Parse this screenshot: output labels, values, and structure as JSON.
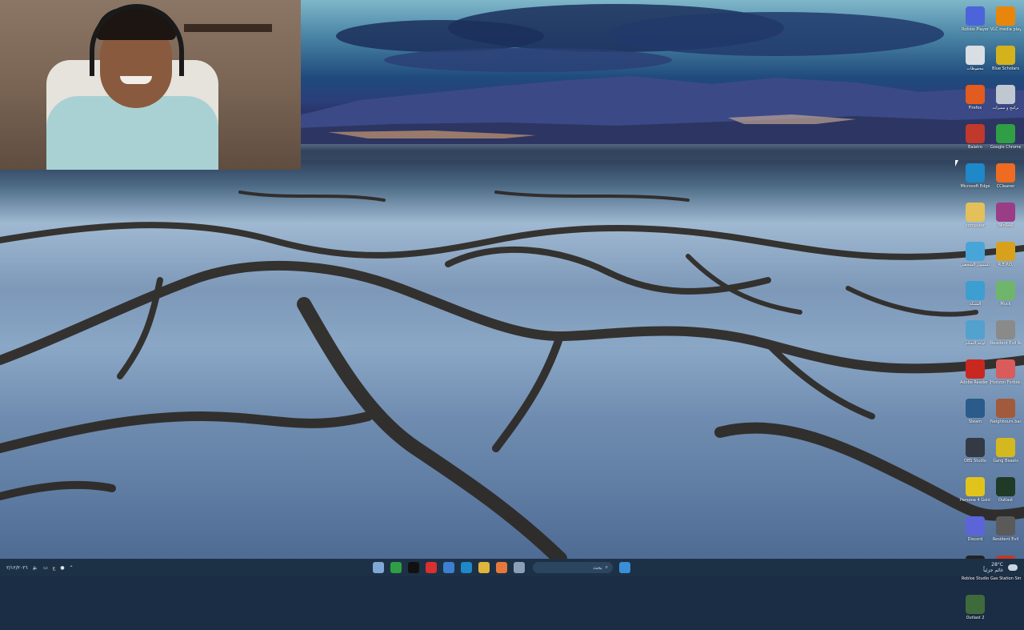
{
  "desktop_icons": [
    {
      "id": "roblox-player",
      "label": "Roblox Player",
      "color": "#4c64d9"
    },
    {
      "id": "vlc",
      "label": "VLC media player",
      "color": "#e8860c"
    },
    {
      "id": "folder-top",
      "label": "محفوظات",
      "color": "#d9dde4"
    },
    {
      "id": "blue-scholar",
      "label": "Blue Scholars",
      "color": "#d4b21c"
    },
    {
      "id": "firefox",
      "label": "Firefox",
      "color": "#e25b1f"
    },
    {
      "id": "settings",
      "label": "برامج و مميزات",
      "color": "#bfc8d0"
    },
    {
      "id": "balatro",
      "label": "Balatro",
      "color": "#c0392b"
    },
    {
      "id": "chrome",
      "label": "Google Chrome",
      "color": "#2f9e44"
    },
    {
      "id": "edge",
      "label": "Microsoft Edge",
      "color": "#1e88c9"
    },
    {
      "id": "ccleaner",
      "label": "CCleaner",
      "color": "#ee6b21"
    },
    {
      "id": "computer-folder",
      "label": "computer",
      "color": "#e4c05a"
    },
    {
      "id": "winrar",
      "label": "WinRAR",
      "color": "#9b3d86"
    },
    {
      "id": "this-pc",
      "label": "هذا الكمبيوتر الشخصي",
      "color": "#48a5d8"
    },
    {
      "id": "repo",
      "label": "R.E.P.O.",
      "color": "#d8a11c"
    },
    {
      "id": "network",
      "label": "الشبكة",
      "color": "#3d9ed1"
    },
    {
      "id": "muck",
      "label": "Muck",
      "color": "#6fb56b"
    },
    {
      "id": "control-panel",
      "label": "لوحة التحكم",
      "color": "#52a1cf"
    },
    {
      "id": "re-requiem",
      "label": "Resident Evil Requiem",
      "color": "#8a8a8a"
    },
    {
      "id": "acrobat",
      "label": "Adobe Reader X",
      "color": "#c8281f"
    },
    {
      "id": "horizon",
      "label": "Horizon Forbidden",
      "color": "#d95b5b"
    },
    {
      "id": "steam",
      "label": "Steam",
      "color": "#2a5b8a"
    },
    {
      "id": "neighbours",
      "label": "Neighbours back From",
      "color": "#a25a3c"
    },
    {
      "id": "obs",
      "label": "OBS Studio",
      "color": "#333a44"
    },
    {
      "id": "gang-beasts",
      "label": "Gang Beasts",
      "color": "#d4b81f"
    },
    {
      "id": "persona4",
      "label": "Persona 4 Golden",
      "color": "#e0c41c"
    },
    {
      "id": "outlast",
      "label": "Outlast",
      "color": "#1f3a26"
    },
    {
      "id": "discord",
      "label": "Discord",
      "color": "#5b65d8"
    },
    {
      "id": "re-village",
      "label": "Resident Evil",
      "color": "#5a5a5a"
    },
    {
      "id": "roblox-studio",
      "label": "Roblox Studio",
      "color": "#222"
    },
    {
      "id": "gas-station",
      "label": "Gas Station Simulator",
      "color": "#c0392b"
    },
    {
      "id": "ostuile",
      "label": "Outlast 2",
      "color": "#3e6a3c"
    }
  ],
  "taskbar": {
    "search_placeholder": "بحث",
    "left_tray_text": "٢/١٢/٢٠٢٦",
    "weather_temp": "28°C",
    "weather_text": "غائم جزئياً",
    "center_icons": [
      {
        "id": "pin",
        "color": "#7fa8d6"
      },
      {
        "id": "chrome",
        "color": "#2f9e44"
      },
      {
        "id": "tiktok",
        "color": "#111"
      },
      {
        "id": "recording",
        "color": "#d93030"
      },
      {
        "id": "paint",
        "color": "#3d7fd1"
      },
      {
        "id": "edge",
        "color": "#1e88c9"
      },
      {
        "id": "files",
        "color": "#e0b53c"
      },
      {
        "id": "photos",
        "color": "#e7783c"
      },
      {
        "id": "desktop",
        "color": "#8ba0b8"
      }
    ],
    "start_color": "#3a8fd6"
  }
}
